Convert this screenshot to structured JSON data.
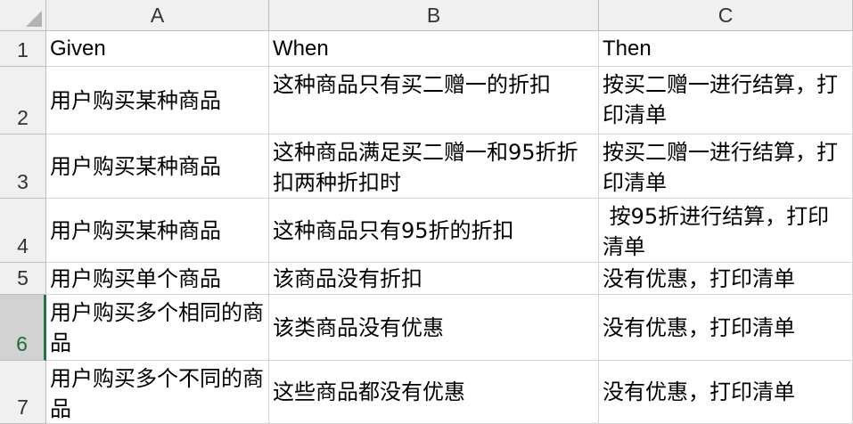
{
  "column_headers": [
    "A",
    "B",
    "C"
  ],
  "row_headers": [
    "1",
    "2",
    "3",
    "4",
    "5",
    "6",
    "7"
  ],
  "selected_row": "6",
  "rows": [
    [
      "Given",
      "When",
      "Then"
    ],
    [
      "用户购买某种商品",
      "这种商品只有买二赠一的折扣",
      "按买二赠一进行结算，打印清单"
    ],
    [
      "用户购买某种商品",
      "这种商品满足买二赠一和95折折扣两种折扣时",
      "按买二赠一进行结算，打印清单"
    ],
    [
      "用户购买某种商品",
      "这种商品只有95折的折扣",
      " 按95折进行结算，打印清单"
    ],
    [
      "用户购买单个商品",
      "该商品没有折扣",
      "没有优惠，打印清单"
    ],
    [
      "用户购买多个相同的商品",
      "该类商品没有优惠",
      "没有优惠，打印清单"
    ],
    [
      "用户购买多个不同的商品",
      "这些商品都没有优惠",
      "没有优惠，打印清单"
    ]
  ],
  "colors": {
    "header_bg": "#f0f0f0",
    "grid_line": "#d4d4d4",
    "selected_row_header_bg": "#d2d2d2",
    "selection_accent": "#217346"
  },
  "icons": {
    "select_all": "select-all-triangle-icon"
  }
}
